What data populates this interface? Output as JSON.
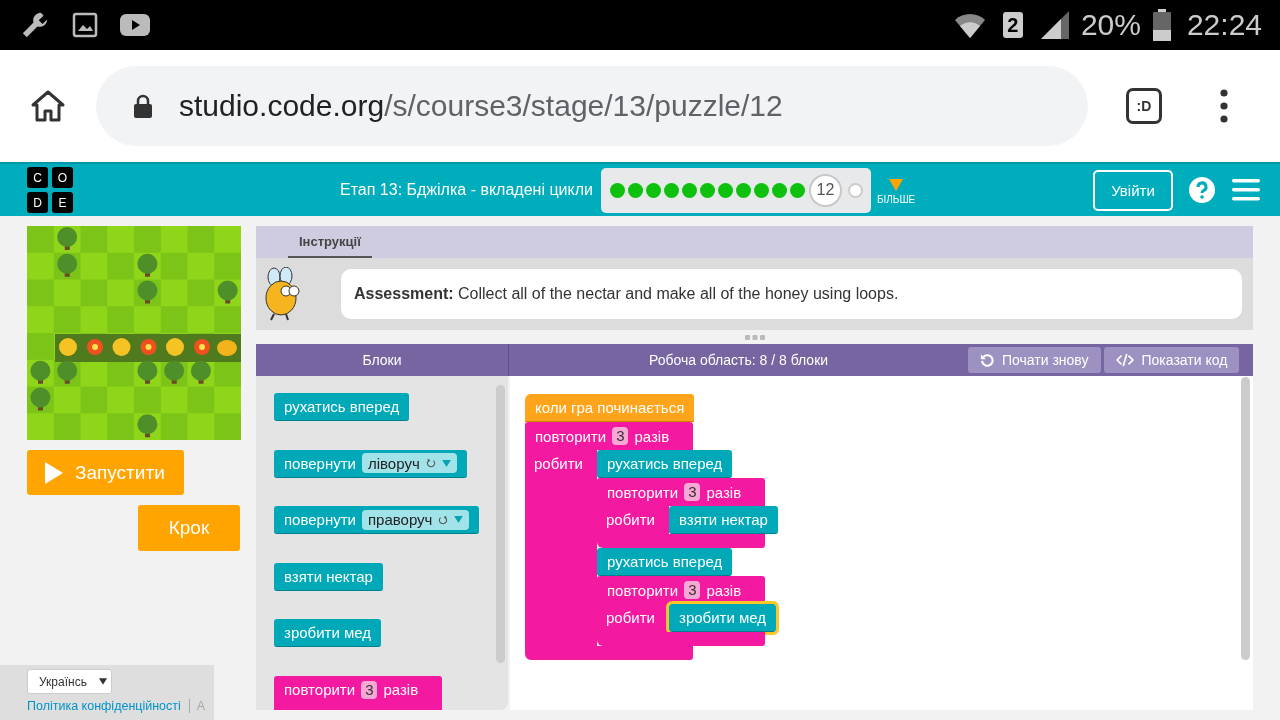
{
  "status_bar": {
    "sim": "2",
    "battery_text": "20%",
    "time": "22:24"
  },
  "browser": {
    "url_host": "studio.code.org",
    "url_path": "/s/course3/stage/13/puzzle/12",
    "tabs_label": ":D"
  },
  "header": {
    "logo_letters": [
      "C",
      "O",
      "D",
      "E"
    ],
    "title": "Етап 13: Бджілка - вкладені цикли",
    "progress": [
      {
        "kind": "dot",
        "completed": true
      },
      {
        "kind": "dot",
        "completed": true
      },
      {
        "kind": "dot",
        "completed": true
      },
      {
        "kind": "dot",
        "completed": true
      },
      {
        "kind": "dot",
        "completed": true
      },
      {
        "kind": "dot",
        "completed": true
      },
      {
        "kind": "dot",
        "completed": true
      },
      {
        "kind": "dot",
        "completed": true
      },
      {
        "kind": "dot",
        "completed": true
      },
      {
        "kind": "dot",
        "completed": true
      },
      {
        "kind": "dot",
        "completed": true
      },
      {
        "kind": "current",
        "label": "12"
      },
      {
        "kind": "dot",
        "completed": false
      }
    ],
    "more_label": "БІЛЬШЕ",
    "sign_in": "Увійти"
  },
  "game": {
    "run_button": "Запустити",
    "step_button": "Крок"
  },
  "footer": {
    "language": "Українсь",
    "links": [
      "Політика конфіденційності",
      "A"
    ]
  },
  "instructions": {
    "tabs": [
      {
        "label": "Інструкції",
        "selected": true
      }
    ],
    "text": "**Assessment:** Collect all of the nectar and make all of the honey using loops."
  },
  "toolbox": {
    "title": "Блоки",
    "blocks": [
      {
        "kind": "action",
        "label": "рухатись вперед"
      },
      {
        "kind": "turn",
        "label": "повернути",
        "option": "ліворуч",
        "clockwise": false
      },
      {
        "kind": "turn",
        "label": "повернути",
        "option": "праворуч",
        "clockwise": true
      },
      {
        "kind": "action",
        "label": "взяти нектар"
      },
      {
        "kind": "action",
        "label": "зробити мед"
      },
      {
        "kind": "repeat",
        "label": "повторити",
        "count": "3",
        "unit": "разів"
      }
    ]
  },
  "workspace": {
    "title": "Робоча область: 8 / 8 блоки",
    "buttons": [
      {
        "kind": "restart",
        "label": "Почати знову"
      },
      {
        "kind": "code",
        "label": "Показати код"
      }
    ],
    "program": [
      {
        "kind": "event",
        "label": "коли гра починається"
      },
      {
        "kind": "repeat",
        "label": "повторити",
        "count": "3",
        "unit": "разів",
        "do_label": "робити",
        "body": [
          {
            "kind": "action",
            "label": "рухатись вперед",
            "selected": false
          },
          {
            "kind": "repeat",
            "label": "повторити",
            "count": "3",
            "unit": "разів",
            "do_label": "робити",
            "body": [
              {
                "kind": "action",
                "label": "взяти нектар",
                "selected": false
              }
            ]
          },
          {
            "kind": "action",
            "label": "рухатись вперед",
            "selected": false
          },
          {
            "kind": "repeat",
            "label": "повторити",
            "count": "3",
            "unit": "разів",
            "do_label": "робити",
            "body": [
              {
                "kind": "action",
                "label": "зробити мед",
                "selected": true
              }
            ]
          }
        ]
      }
    ]
  }
}
